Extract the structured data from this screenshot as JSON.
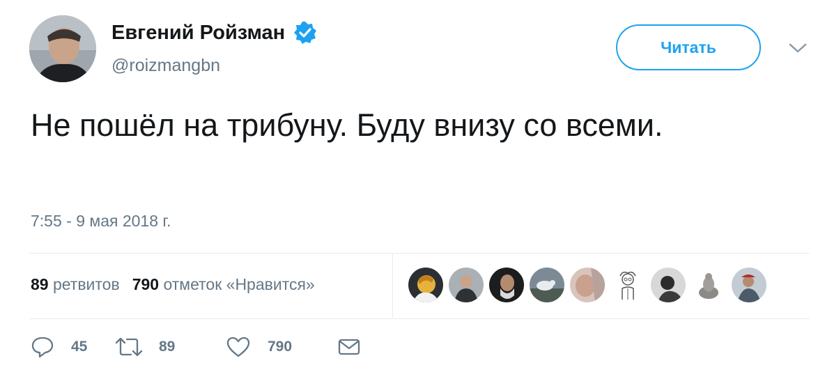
{
  "user": {
    "display_name": "Евгений Ройзман",
    "handle": "@roizmangbn",
    "verified_icon": "verified-badge-icon",
    "avatar": "avatar-photo"
  },
  "follow_button": {
    "label": "Читать"
  },
  "menu": {
    "icon": "chevron-down-icon"
  },
  "tweet": {
    "text": "Не пошёл на трибуну. Буду внизу со всеми.",
    "timestamp": "7:55 - 9 мая 2018 г."
  },
  "stats": {
    "retweets_count": "89",
    "retweets_label": "ретвитов",
    "likes_count": "790",
    "likes_label": "отметок «Нравится»"
  },
  "likers": [
    {
      "icon": "avatar-cartoon"
    },
    {
      "icon": "avatar-person"
    },
    {
      "icon": "avatar-person"
    },
    {
      "icon": "avatar-bird"
    },
    {
      "icon": "avatar-person"
    },
    {
      "icon": "avatar-illustration"
    },
    {
      "icon": "avatar-bw"
    },
    {
      "icon": "avatar-figurine"
    },
    {
      "icon": "avatar-person"
    }
  ],
  "actions": {
    "reply_count": "45",
    "retweet_count": "89",
    "like_count": "790"
  },
  "colors": {
    "accent": "#1da1f2",
    "muted": "#657786",
    "text": "#14171a",
    "divider": "#e6ecf0"
  }
}
